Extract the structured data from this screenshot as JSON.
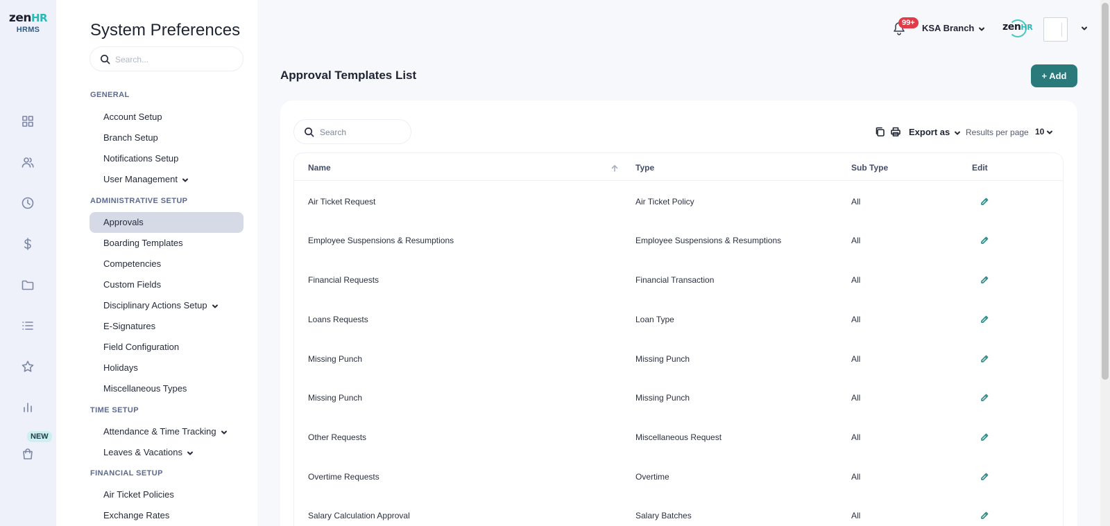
{
  "brand": {
    "logo_word": "zen",
    "logo_hr": "HR",
    "product": "HRMS"
  },
  "rail": {
    "icons": [
      "dashboard-icon",
      "people-icon",
      "clock-icon",
      "dollar-icon",
      "folder-icon",
      "list-icon",
      "star-icon",
      "bar-chart-icon",
      "shopping-bag-icon"
    ],
    "new_badge": "NEW"
  },
  "sidebar": {
    "title": "System Preferences",
    "search_placeholder": "Search...",
    "sections": [
      {
        "label": "GENERAL",
        "items": [
          {
            "label": "Account Setup"
          },
          {
            "label": "Branch Setup"
          },
          {
            "label": "Notifications Setup"
          },
          {
            "label": "User Management",
            "expandable": true
          }
        ]
      },
      {
        "label": "ADMINISTRATIVE SETUP",
        "items": [
          {
            "label": "Approvals",
            "active": true
          },
          {
            "label": "Boarding Templates"
          },
          {
            "label": "Competencies"
          },
          {
            "label": "Custom Fields"
          },
          {
            "label": "Disciplinary Actions Setup",
            "expandable": true
          },
          {
            "label": "E-Signatures"
          },
          {
            "label": "Field Configuration"
          },
          {
            "label": "Holidays"
          },
          {
            "label": "Miscellaneous Types"
          }
        ]
      },
      {
        "label": "TIME SETUP",
        "items": [
          {
            "label": "Attendance & Time Tracking",
            "expandable": true
          },
          {
            "label": "Leaves & Vacations",
            "expandable": true
          }
        ]
      },
      {
        "label": "FINANCIAL SETUP",
        "items": [
          {
            "label": "Air Ticket Policies"
          },
          {
            "label": "Exchange Rates"
          }
        ]
      }
    ]
  },
  "header": {
    "notifications_count": "99+",
    "branch": "KSA Branch",
    "mini_logo_word": "zen",
    "mini_logo_hr": "HR"
  },
  "main": {
    "title": "Approval Templates List",
    "add_label": "+ Add",
    "search_placeholder": "Search",
    "export_label": "Export as",
    "results_per_page_label": "Results per page",
    "results_per_page_value": "10"
  },
  "table": {
    "columns": [
      "Name",
      "Type",
      "Sub Type",
      "Edit"
    ],
    "rows": [
      {
        "name": "Air Ticket Request",
        "type": "Air Ticket Policy",
        "sub_type": "All"
      },
      {
        "name": "Employee Suspensions & Resumptions",
        "type": "Employee Suspensions & Resumptions",
        "sub_type": "All"
      },
      {
        "name": "Financial Requests",
        "type": "Financial Transaction",
        "sub_type": "All"
      },
      {
        "name": "Loans Requests",
        "type": "Loan Type",
        "sub_type": "All"
      },
      {
        "name": "Missing Punch",
        "type": "Missing Punch",
        "sub_type": "All"
      },
      {
        "name": "Missing Punch",
        "type": "Missing Punch",
        "sub_type": "All"
      },
      {
        "name": "Other Requests",
        "type": "Miscellaneous Request",
        "sub_type": "All"
      },
      {
        "name": "Overtime Requests",
        "type": "Overtime",
        "sub_type": "All"
      },
      {
        "name": "Salary Calculation Approval",
        "type": "Salary Batches",
        "sub_type": "All"
      }
    ]
  },
  "colors": {
    "accent": "#2a7a7c",
    "badge_red": "#e23a47",
    "active_item": "#d5dae6",
    "rail_bg": "#eef0fa"
  }
}
